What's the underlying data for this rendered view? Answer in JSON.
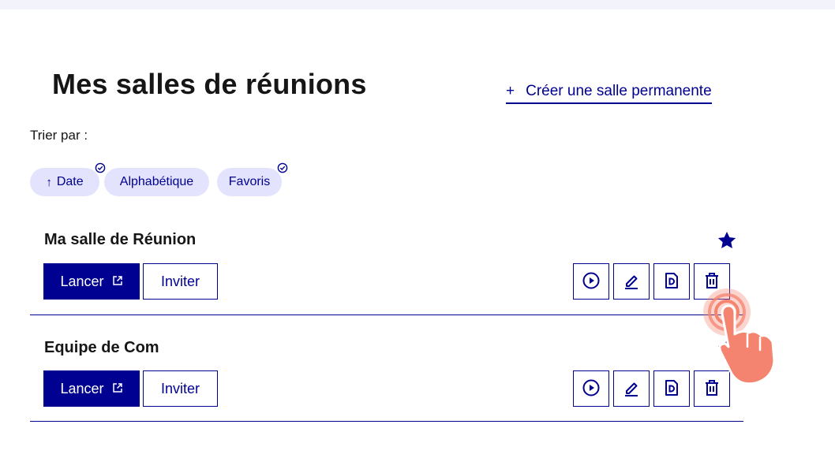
{
  "page": {
    "title": "Mes salles de réunions",
    "create_link_plus": "+",
    "create_link_label": "Créer une salle permanente"
  },
  "sort": {
    "label": "Trier par :",
    "options": [
      {
        "label": "Date",
        "arrow": "↑",
        "selected": true
      },
      {
        "label": "Alphabétique",
        "selected": false
      },
      {
        "label": "Favoris",
        "selected": true
      }
    ]
  },
  "rooms": [
    {
      "name": "Ma salle de Réunion",
      "favorite": true,
      "launch_label": "Lancer",
      "invite_label": "Inviter"
    },
    {
      "name": "Equipe de Com",
      "favorite": true,
      "launch_label": "Lancer",
      "invite_label": "Inviter"
    }
  ],
  "colors": {
    "primary": "#000091",
    "tag_bg": "#e3e3fd",
    "cursor": "#f4836f"
  },
  "icons": [
    "play-icon",
    "edit-icon",
    "document-icon",
    "trash-icon",
    "star-icon",
    "external-link-icon",
    "check-circle-icon",
    "hand-pointer-icon"
  ]
}
